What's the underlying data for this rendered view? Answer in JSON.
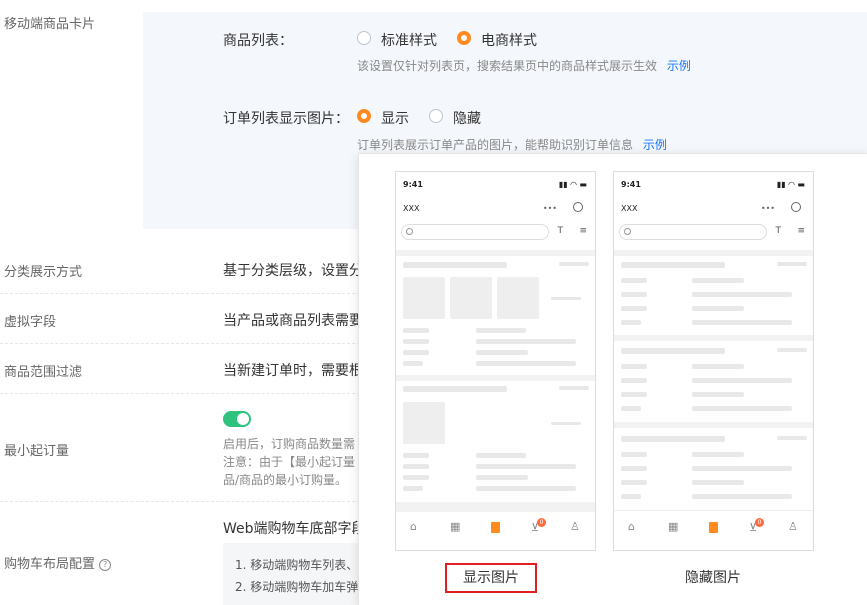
{
  "mobile_card": {
    "section_label": "移动端商品卡片",
    "product_list_label": "商品列表：",
    "option_standard": "标准样式",
    "option_ecommerce": "电商样式",
    "product_list_hint": "该设置仅针对列表页，搜索结果页中的商品样式展示生效",
    "product_list_example": "示例",
    "order_image_label": "订单列表显示图片：",
    "option_show": "显示",
    "option_hide": "隐藏",
    "order_image_hint": "订单列表展示订单产品的图片，能帮助识别订单信息",
    "order_image_example": "示例"
  },
  "rows": {
    "category_display": {
      "label": "分类展示方式",
      "value": "基于分类层级，设置分"
    },
    "virtual_field": {
      "label": "虚拟字段",
      "value": "当产品或商品列表需要"
    },
    "product_filter": {
      "label": "商品范围过滤",
      "value": "当新建订单时，需要根"
    },
    "min_order": {
      "label": "最小起订量",
      "hint_line1": "启用后，订购商品数量需",
      "hint_line2": "注意：由于【最小起订量",
      "hint_line3": "品/商品的最小订购量。"
    },
    "cart_layout": {
      "label": "购物车布局配置",
      "web_title": "Web端购物车底部字段",
      "item1": "1. 移动端购物车列表、",
      "item2": "2. 移动端购物车加车弹"
    }
  },
  "popup": {
    "left_caption": "显示图片",
    "right_caption": "隐藏图片",
    "phone_time": "9:41",
    "phone_title": "XXX",
    "cart_badge": "0",
    "caption_highlight_color": "#e02020"
  },
  "colors": {
    "accent": "#ff8a1f",
    "toggle": "#2ec27e",
    "link": "#1677ff"
  }
}
